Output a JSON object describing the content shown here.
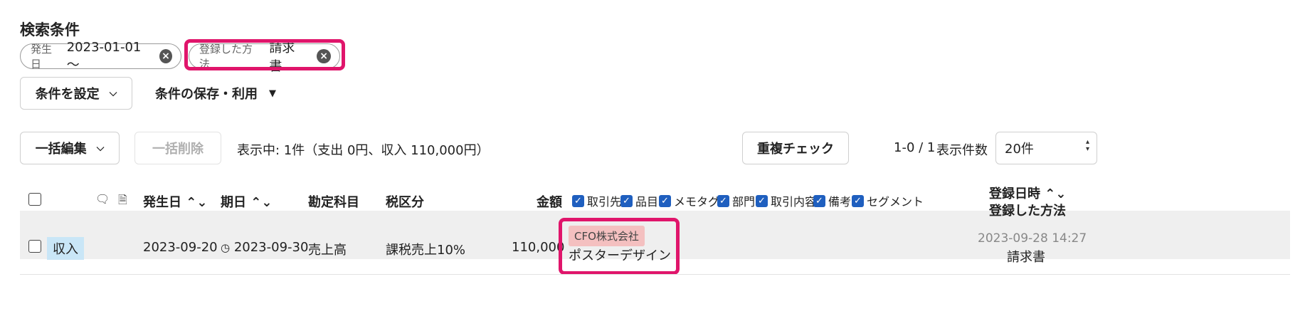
{
  "search": {
    "title": "検索条件",
    "chips": [
      {
        "label": "発生日",
        "value": "2023-01-01 〜"
      },
      {
        "label": "登録した方法",
        "value": "請求書"
      }
    ],
    "set_condition": "条件を設定",
    "save_use": "条件の保存・利用"
  },
  "toolbar": {
    "bulk_edit": "一括編集",
    "bulk_delete": "一括削除",
    "display_status": "表示中: 1件（支出 0円、収入 110,000円）",
    "duplicate_check": "重複チェック",
    "pagination": "1-0 / 1",
    "per_page_label": "表示件数",
    "per_page_value": "20件"
  },
  "table": {
    "headers": {
      "date": "発生日",
      "due": "期日",
      "account": "勘定科目",
      "tax": "税区分",
      "amount": "金額",
      "registered_at": "登録日時",
      "registered_method": "登録した方法"
    },
    "column_toggles": [
      "取引先",
      "品目",
      "メモタグ",
      "部門",
      "取引内容",
      "備考",
      "セグメント"
    ],
    "rows": [
      {
        "type": "収入",
        "date": "2023-09-20",
        "due": "2023-09-30",
        "account": "売上高",
        "tax": "課税売上10%",
        "amount": "110,000",
        "partner": "CFO株式会社",
        "description": "ポスターデザイン",
        "registered_at": "2023-09-28 14:27",
        "registered_method": "請求書"
      }
    ]
  },
  "colors": {
    "highlight": "#e0156b",
    "income_badge": "#c9e6f7",
    "partner_tag": "#f4c0c0",
    "checkbox_checked": "#1f5fbf"
  }
}
